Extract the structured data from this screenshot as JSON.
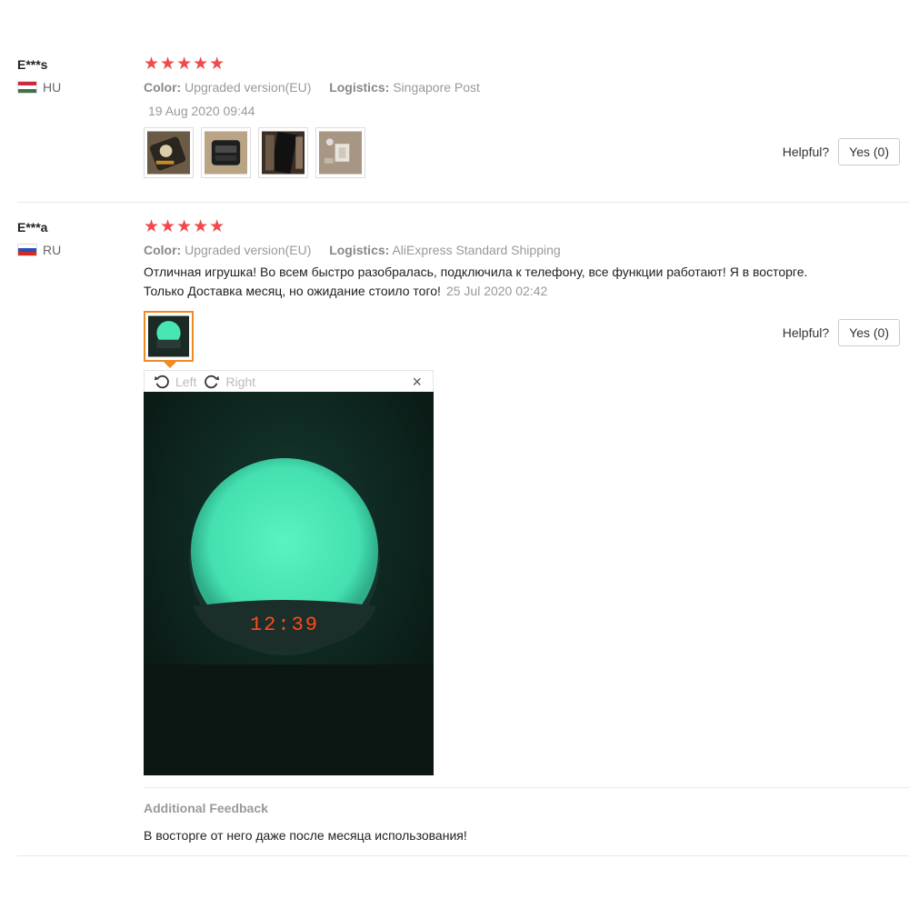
{
  "reviews": [
    {
      "user": "E***s",
      "country": "HU",
      "stars": "★★★★★",
      "rating": 5,
      "color_label": "Color:",
      "color_value": "Upgraded version(EU)",
      "logistics_label": "Logistics:",
      "logistics_value": "Singapore Post",
      "date": "19 Aug 2020 09:44",
      "helpful_label": "Helpful?",
      "yes_label": "Yes (0)"
    },
    {
      "user": "E***a",
      "country": "RU",
      "stars": "★★★★★",
      "rating": 5,
      "color_label": "Color:",
      "color_value": "Upgraded version(EU)",
      "logistics_label": "Logistics:",
      "logistics_value": "AliExpress Standard Shipping",
      "text_line1": "Отличная игрушка! Во всем быстро разобралась, подключила к телефону, все функции работают! Я в восторге.",
      "text_line2": "Только Доставка месяц, но ожидание стоило того!",
      "date": "25 Jul 2020 02:42",
      "helpful_label": "Helpful?",
      "yes_label": "Yes (0)",
      "viewer": {
        "left_label": "Left",
        "right_label": "Right",
        "close_glyph": "×",
        "clock_display": "12:39"
      },
      "additional_title": "Additional Feedback",
      "additional_text": "В восторге от него даже после месяца использования!"
    }
  ],
  "colors": {
    "star": "#f04a4a",
    "active_thumb_border": "#f08a24",
    "muted_text": "#999999"
  }
}
